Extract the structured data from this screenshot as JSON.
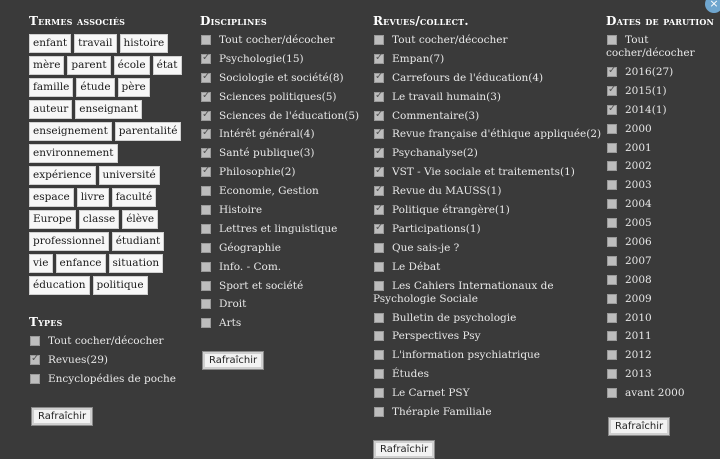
{
  "termes": {
    "title": "Termes associés",
    "tags": [
      "enfant",
      "travail",
      "histoire",
      "mère",
      "parent",
      "école",
      "état",
      "famille",
      "étude",
      "père",
      "auteur",
      "enseignant",
      "enseignement",
      "parentalité",
      "environnement",
      "expérience",
      "université",
      "espace",
      "livre",
      "faculté",
      "Europe",
      "classe",
      "élève",
      "professionnel",
      "étudiant",
      "vie",
      "enfance",
      "situation",
      "éducation",
      "politique"
    ]
  },
  "types": {
    "title": "Types",
    "items": [
      {
        "label": "Tout cocher/décocher",
        "checked": false
      },
      {
        "label": "Revues(29)",
        "checked": true
      },
      {
        "label": "Encyclopédies de poche",
        "checked": false
      }
    ],
    "refresh": "Rafraîchir"
  },
  "disciplines": {
    "title": "Disciplines",
    "items": [
      {
        "label": "Tout cocher/décocher",
        "checked": false
      },
      {
        "label": "Psychologie(15)",
        "checked": true
      },
      {
        "label": "Sociologie et société(8)",
        "checked": true
      },
      {
        "label": "Sciences politiques(5)",
        "checked": true
      },
      {
        "label": "Sciences de l'éducation(5)",
        "checked": true
      },
      {
        "label": "Intérêt général(4)",
        "checked": true
      },
      {
        "label": "Santé publique(3)",
        "checked": true
      },
      {
        "label": "Philosophie(2)",
        "checked": true
      },
      {
        "label": "Economie, Gestion",
        "checked": false
      },
      {
        "label": "Histoire",
        "checked": false
      },
      {
        "label": "Lettres et linguistique",
        "checked": false
      },
      {
        "label": "Géographie",
        "checked": false
      },
      {
        "label": "Info. - Com.",
        "checked": false
      },
      {
        "label": "Sport et société",
        "checked": false
      },
      {
        "label": "Droit",
        "checked": false
      },
      {
        "label": "Arts",
        "checked": false
      }
    ],
    "refresh": "Rafraîchir"
  },
  "revues": {
    "title": "Revues/collect.",
    "items": [
      {
        "label": "Tout cocher/décocher",
        "checked": false
      },
      {
        "label": "Empan(7)",
        "checked": true
      },
      {
        "label": "Carrefours de l'éducation(4)",
        "checked": true
      },
      {
        "label": "Le travail humain(3)",
        "checked": true
      },
      {
        "label": "Commentaire(3)",
        "checked": true
      },
      {
        "label": "Revue française d'éthique appliquée(2)",
        "checked": true
      },
      {
        "label": "Psychanalyse(2)",
        "checked": true
      },
      {
        "label": "VST - Vie sociale et traitements(1)",
        "checked": true
      },
      {
        "label": "Revue du MAUSS(1)",
        "checked": true
      },
      {
        "label": "Politique étrangère(1)",
        "checked": true
      },
      {
        "label": "Participations(1)",
        "checked": true
      },
      {
        "label": "Que sais-je ?",
        "checked": false
      },
      {
        "label": "Le Débat",
        "checked": false
      },
      {
        "label": "Les Cahiers Internationaux de Psychologie Sociale",
        "checked": false
      },
      {
        "label": "Bulletin de psychologie",
        "checked": false
      },
      {
        "label": "Perspectives Psy",
        "checked": false
      },
      {
        "label": "L'information psychiatrique",
        "checked": false
      },
      {
        "label": "Études",
        "checked": false
      },
      {
        "label": "Le Carnet PSY",
        "checked": false
      },
      {
        "label": "Thérapie Familiale",
        "checked": false
      }
    ],
    "refresh": "Rafraîchir"
  },
  "dates": {
    "title": "Dates de parution",
    "items": [
      {
        "label": "Tout cocher/décocher",
        "checked": false
      },
      {
        "label": "2016(27)",
        "checked": true
      },
      {
        "label": "2015(1)",
        "checked": true
      },
      {
        "label": "2014(1)",
        "checked": true
      },
      {
        "label": "2000",
        "checked": false
      },
      {
        "label": "2001",
        "checked": false
      },
      {
        "label": "2002",
        "checked": false
      },
      {
        "label": "2003",
        "checked": false
      },
      {
        "label": "2004",
        "checked": false
      },
      {
        "label": "2005",
        "checked": false
      },
      {
        "label": "2006",
        "checked": false
      },
      {
        "label": "2007",
        "checked": false
      },
      {
        "label": "2008",
        "checked": false
      },
      {
        "label": "2009",
        "checked": false
      },
      {
        "label": "2010",
        "checked": false
      },
      {
        "label": "2011",
        "checked": false
      },
      {
        "label": "2012",
        "checked": false
      },
      {
        "label": "2013",
        "checked": false
      },
      {
        "label": "avant 2000",
        "checked": false
      }
    ],
    "refresh": "Rafraîchir"
  },
  "close": "×"
}
